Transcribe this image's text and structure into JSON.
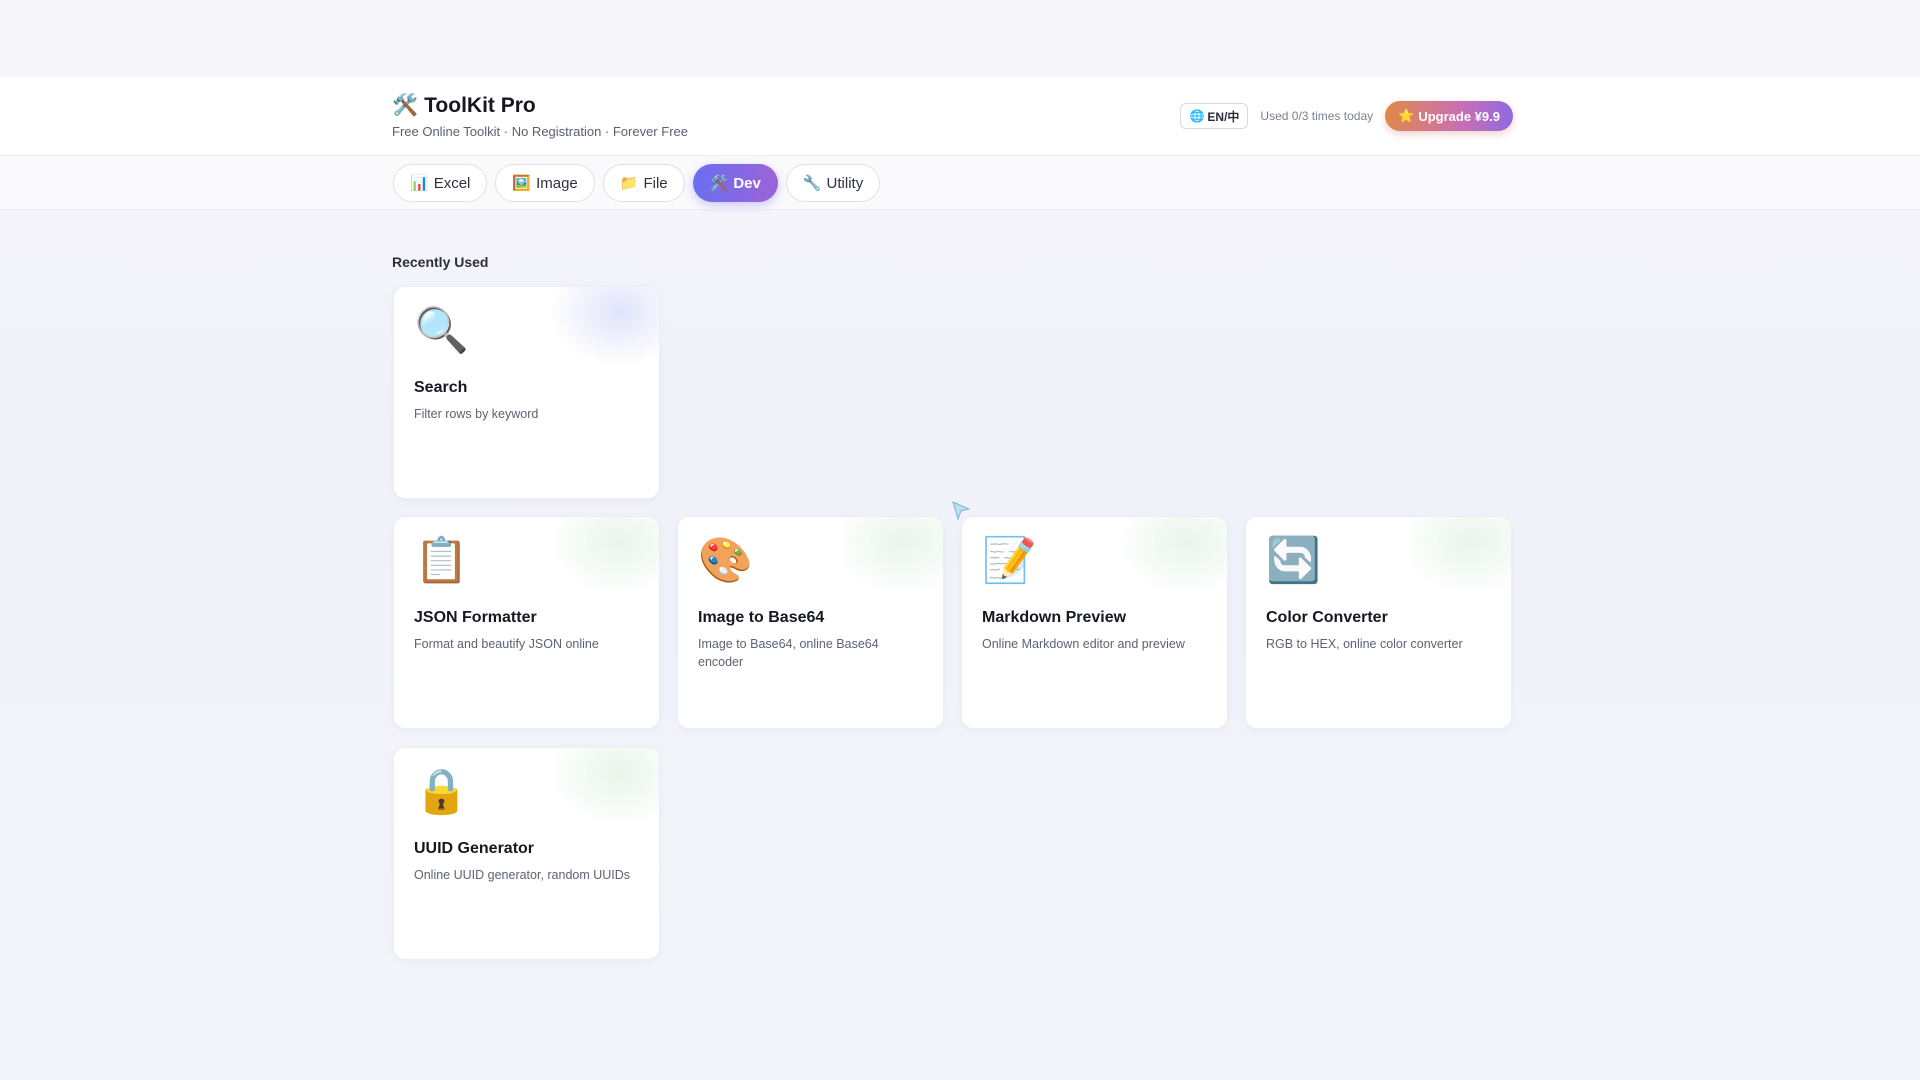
{
  "header": {
    "logo_icon": "🛠️",
    "title": "ToolKit Pro",
    "subtitle": "Free Online Toolkit · No Registration · Forever Free",
    "lang_icon": "🌐",
    "lang_label": "EN/中",
    "usage_text": "Used 0/3 times today",
    "upgrade_icon": "⭐",
    "upgrade_label": "Upgrade ¥9.9"
  },
  "tabs": [
    {
      "icon": "📊",
      "label": "Excel",
      "active": false
    },
    {
      "icon": "🖼️",
      "label": "Image",
      "active": false
    },
    {
      "icon": "📁",
      "label": "File",
      "active": false
    },
    {
      "icon": "🛠️",
      "label": "Dev",
      "active": true
    },
    {
      "icon": "🔧",
      "label": "Utility",
      "active": false
    }
  ],
  "recent": {
    "title": "Recently Used",
    "cards": [
      {
        "icon": "🔍",
        "icon_name": "magnifier-icon",
        "title": "Search",
        "desc": "Filter rows by keyword"
      }
    ]
  },
  "tools": [
    {
      "icon": "📋",
      "icon_name": "clipboard-icon",
      "title": "JSON Formatter",
      "desc": "Format and beautify JSON online"
    },
    {
      "icon": "🎨",
      "icon_name": "palette-icon",
      "title": "Image to Base64",
      "desc": "Image to Base64, online Base64 encoder"
    },
    {
      "icon": "📝",
      "icon_name": "memo-icon",
      "title": "Markdown Preview",
      "desc": "Online Markdown editor and preview"
    },
    {
      "icon": "🔄",
      "icon_name": "refresh-icon",
      "title": "Color Converter",
      "desc": "RGB to HEX, online color converter"
    },
    {
      "icon": "🔒",
      "icon_name": "lock-icon",
      "title": "UUID Generator",
      "desc": "Online UUID generator, random UUIDs"
    }
  ],
  "colors": {
    "accent_start": "#6a6ff0",
    "accent_end": "#9c63d8",
    "upgrade_start": "#e0894a",
    "upgrade_end": "#8f6ae0"
  }
}
